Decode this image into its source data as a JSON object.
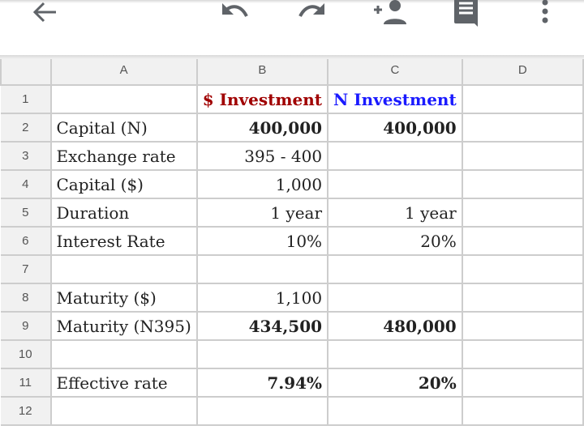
{
  "toolbar": {
    "icons": [
      "back-arrow-icon",
      "undo-icon",
      "redo-icon",
      "add-person-icon",
      "comment-icon",
      "more-vert-icon"
    ]
  },
  "sheet": {
    "columns": [
      "",
      "A",
      "B",
      "C",
      "D"
    ],
    "rows": [
      {
        "num": "1",
        "A": "",
        "B": "$ Investment",
        "C": "N Investment",
        "D": ""
      },
      {
        "num": "2",
        "A": "Capital (N)",
        "B": "400,000",
        "C": "400,000",
        "D": ""
      },
      {
        "num": "3",
        "A": "Exchange rate",
        "B": "395 - 400",
        "C": "",
        "D": ""
      },
      {
        "num": "4",
        "A": "Capital ($)",
        "B": "1,000",
        "C": "",
        "D": ""
      },
      {
        "num": "5",
        "A": "Duration",
        "B": "1 year",
        "C": "1 year",
        "D": ""
      },
      {
        "num": "6",
        "A": "Interest Rate",
        "B": "10%",
        "C": "20%",
        "D": ""
      },
      {
        "num": "7",
        "A": "",
        "B": "",
        "C": "",
        "D": ""
      },
      {
        "num": "8",
        "A": "Maturity ($)",
        "B": "1,100",
        "C": "",
        "D": ""
      },
      {
        "num": "9",
        "A": "Maturity (N395)",
        "B": "434,500",
        "C": "480,000",
        "D": ""
      },
      {
        "num": "10",
        "A": "",
        "B": "",
        "C": "",
        "D": ""
      },
      {
        "num": "11",
        "A": "Effective rate",
        "B": "7.94%",
        "C": "20%",
        "D": ""
      },
      {
        "num": "12",
        "A": "",
        "B": "",
        "C": "",
        "D": ""
      }
    ],
    "colors": {
      "dollar_header": "#a00000",
      "naira_header": "#1a1aff"
    }
  }
}
